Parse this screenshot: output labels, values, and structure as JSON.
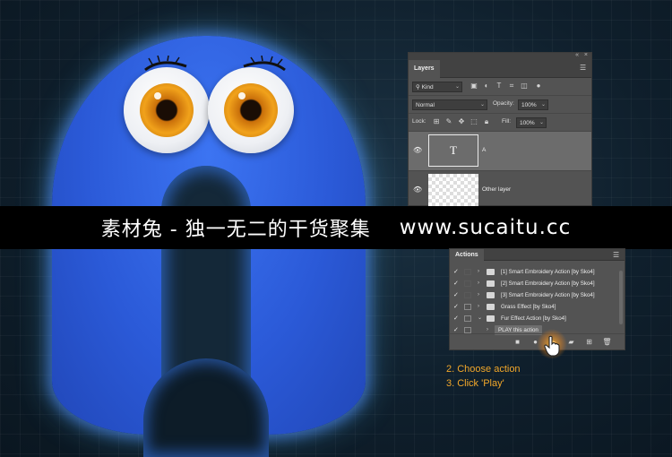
{
  "watermark": {
    "brand": "素材兔 - 独一无二的干货聚集",
    "url": "www.sucaitu.cc"
  },
  "layers_panel": {
    "tab": "Layers",
    "filter_kind": "Kind",
    "blend_mode": "Normal",
    "opacity_label": "Opacity:",
    "opacity_value": "100%",
    "lock_label": "Lock:",
    "fill_label": "Fill:",
    "fill_value": "100%",
    "layers": [
      {
        "name": "A",
        "thumb_glyph": "T",
        "visible": true,
        "selected": true
      },
      {
        "name": "Other layer",
        "visible": true,
        "selected": false
      }
    ]
  },
  "actions_panel": {
    "tab": "Actions",
    "items": [
      {
        "label": "[1] Smart Embroidery Action [by Sko4]",
        "checked": true,
        "dialog": false,
        "expanded": false,
        "type": "set"
      },
      {
        "label": "[2] Smart Embroidery Action [by Sko4]",
        "checked": true,
        "dialog": false,
        "expanded": false,
        "type": "set"
      },
      {
        "label": "[3] Smart Embroidery Action [by Sko4]",
        "checked": true,
        "dialog": false,
        "expanded": false,
        "type": "set"
      },
      {
        "label": "Grass Effect [by Sko4]",
        "checked": true,
        "dialog": true,
        "expanded": false,
        "type": "set"
      },
      {
        "label": "Fur Effect Action [by Sko4]",
        "checked": true,
        "dialog": true,
        "expanded": true,
        "type": "set"
      },
      {
        "label": "PLAY this action",
        "checked": true,
        "dialog": true,
        "expanded": false,
        "type": "action",
        "selected": true
      }
    ]
  },
  "instructions": {
    "step2": "2. Choose action",
    "step3": "3. Click 'Play'"
  },
  "colors": {
    "accent_orange": "#f2a72a",
    "fur_blue": "#2f63e0",
    "panel_gray": "#535353"
  }
}
